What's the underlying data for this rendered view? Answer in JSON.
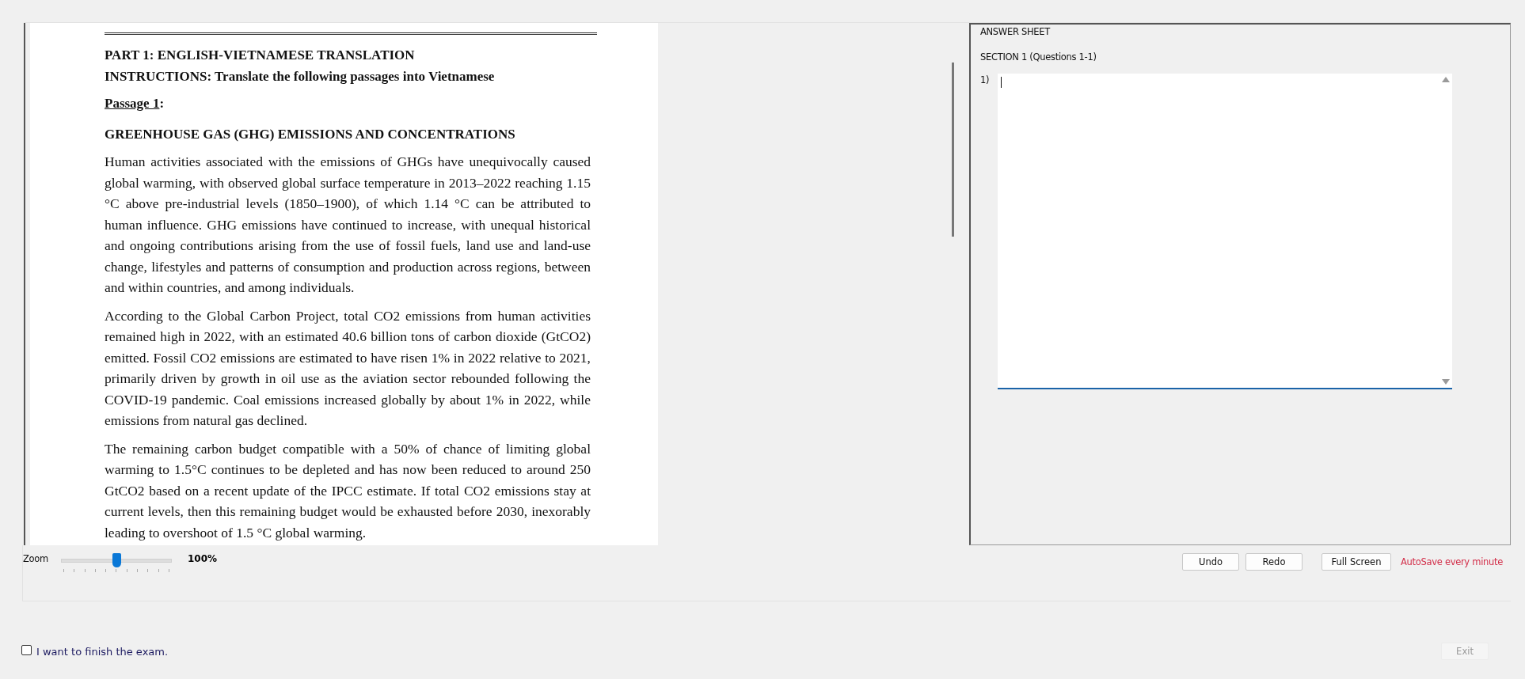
{
  "document": {
    "part_title": "PART 1: ENGLISH-VIETNAMESE TRANSLATION",
    "instructions": "INSTRUCTIONS: Translate the following passages into Vietnamese",
    "passage_label": "Passage 1",
    "passage_label_suffix": ":",
    "heading": "GREENHOUSE GAS (GHG) EMISSIONS AND CONCENTRATIONS",
    "paragraphs": [
      "Human activities associated with the emissions of GHGs have unequivocally caused global warming, with observed global surface temperature in 2013–2022 reaching 1.15 °C above pre-industrial levels (1850–1900), of which 1.14 °C can be attributed to human influence. GHG emissions have continued to increase, with unequal historical and ongoing contributions arising from the use of fossil fuels, land use and land-use change, lifestyles and patterns of consumption and production across regions, between and within countries, and among individuals.",
      "According to the Global Carbon Project, total CO2 emissions from human activities remained high in 2022, with an estimated 40.6 billion tons of carbon dioxide (GtCO2) emitted. Fossil CO2 emissions are estimated to have risen 1% in 2022 relative to 2021, primarily driven by growth in oil use as the aviation sector rebounded following the COVID-19 pandemic. Coal emissions increased globally by about 1% in 2022, while emissions from natural gas declined.",
      "The remaining carbon budget compatible with a 50% of chance of limiting global warming to 1.5°C continues to be depleted and has now been reduced to around 250 GtCO2 based on a recent update of the IPCC estimate. If total CO2 emissions stay at current levels, then this remaining budget would be exhausted before 2030, inexorably leading to overshoot of 1.5 °C global warming."
    ]
  },
  "answer_sheet": {
    "title": "ANSWER SHEET",
    "section": "SECTION 1 (Questions 1-1)",
    "questions": [
      {
        "number": "1)",
        "focused": true
      }
    ]
  },
  "zoom": {
    "label": "Zoom",
    "level": 0.5,
    "reading": "100%"
  },
  "buttons": [
    {
      "label": "Undo",
      "disabled": false
    },
    {
      "label": "Redo",
      "disabled": false
    },
    {
      "label": "Full Screen",
      "disabled": false
    }
  ],
  "autosave_note": "AutoSave every minute",
  "finish": {
    "label": "I want to finish the exam.",
    "checked": false
  },
  "exit_button": {
    "label": "Exit",
    "disabled": true
  }
}
